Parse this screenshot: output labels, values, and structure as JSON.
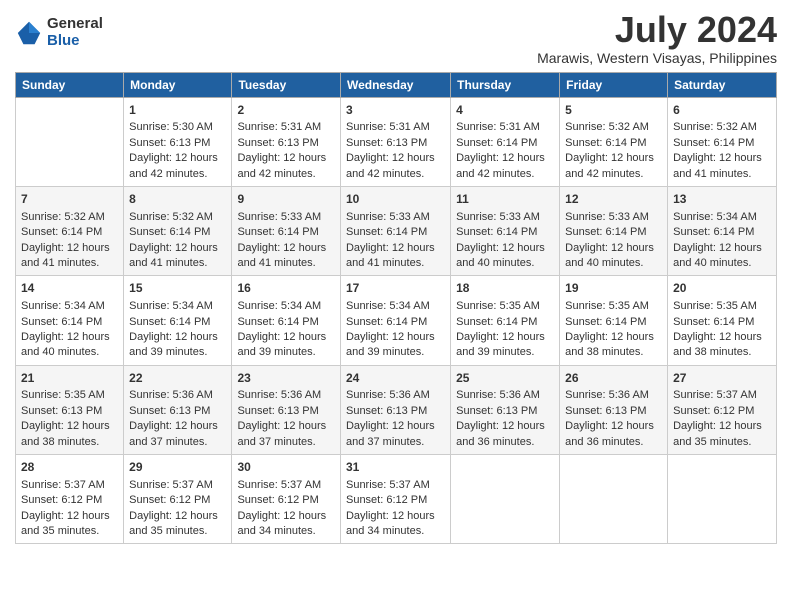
{
  "logo": {
    "general": "General",
    "blue": "Blue"
  },
  "title": {
    "month_year": "July 2024",
    "location": "Marawis, Western Visayas, Philippines"
  },
  "days_of_week": [
    "Sunday",
    "Monday",
    "Tuesday",
    "Wednesday",
    "Thursday",
    "Friday",
    "Saturday"
  ],
  "weeks": [
    [
      {
        "day": "",
        "sunrise": "",
        "sunset": "",
        "daylight": ""
      },
      {
        "day": "1",
        "sunrise": "Sunrise: 5:30 AM",
        "sunset": "Sunset: 6:13 PM",
        "daylight": "Daylight: 12 hours and 42 minutes."
      },
      {
        "day": "2",
        "sunrise": "Sunrise: 5:31 AM",
        "sunset": "Sunset: 6:13 PM",
        "daylight": "Daylight: 12 hours and 42 minutes."
      },
      {
        "day": "3",
        "sunrise": "Sunrise: 5:31 AM",
        "sunset": "Sunset: 6:13 PM",
        "daylight": "Daylight: 12 hours and 42 minutes."
      },
      {
        "day": "4",
        "sunrise": "Sunrise: 5:31 AM",
        "sunset": "Sunset: 6:14 PM",
        "daylight": "Daylight: 12 hours and 42 minutes."
      },
      {
        "day": "5",
        "sunrise": "Sunrise: 5:32 AM",
        "sunset": "Sunset: 6:14 PM",
        "daylight": "Daylight: 12 hours and 42 minutes."
      },
      {
        "day": "6",
        "sunrise": "Sunrise: 5:32 AM",
        "sunset": "Sunset: 6:14 PM",
        "daylight": "Daylight: 12 hours and 41 minutes."
      }
    ],
    [
      {
        "day": "7",
        "sunrise": "Sunrise: 5:32 AM",
        "sunset": "Sunset: 6:14 PM",
        "daylight": "Daylight: 12 hours and 41 minutes."
      },
      {
        "day": "8",
        "sunrise": "Sunrise: 5:32 AM",
        "sunset": "Sunset: 6:14 PM",
        "daylight": "Daylight: 12 hours and 41 minutes."
      },
      {
        "day": "9",
        "sunrise": "Sunrise: 5:33 AM",
        "sunset": "Sunset: 6:14 PM",
        "daylight": "Daylight: 12 hours and 41 minutes."
      },
      {
        "day": "10",
        "sunrise": "Sunrise: 5:33 AM",
        "sunset": "Sunset: 6:14 PM",
        "daylight": "Daylight: 12 hours and 41 minutes."
      },
      {
        "day": "11",
        "sunrise": "Sunrise: 5:33 AM",
        "sunset": "Sunset: 6:14 PM",
        "daylight": "Daylight: 12 hours and 40 minutes."
      },
      {
        "day": "12",
        "sunrise": "Sunrise: 5:33 AM",
        "sunset": "Sunset: 6:14 PM",
        "daylight": "Daylight: 12 hours and 40 minutes."
      },
      {
        "day": "13",
        "sunrise": "Sunrise: 5:34 AM",
        "sunset": "Sunset: 6:14 PM",
        "daylight": "Daylight: 12 hours and 40 minutes."
      }
    ],
    [
      {
        "day": "14",
        "sunrise": "Sunrise: 5:34 AM",
        "sunset": "Sunset: 6:14 PM",
        "daylight": "Daylight: 12 hours and 40 minutes."
      },
      {
        "day": "15",
        "sunrise": "Sunrise: 5:34 AM",
        "sunset": "Sunset: 6:14 PM",
        "daylight": "Daylight: 12 hours and 39 minutes."
      },
      {
        "day": "16",
        "sunrise": "Sunrise: 5:34 AM",
        "sunset": "Sunset: 6:14 PM",
        "daylight": "Daylight: 12 hours and 39 minutes."
      },
      {
        "day": "17",
        "sunrise": "Sunrise: 5:34 AM",
        "sunset": "Sunset: 6:14 PM",
        "daylight": "Daylight: 12 hours and 39 minutes."
      },
      {
        "day": "18",
        "sunrise": "Sunrise: 5:35 AM",
        "sunset": "Sunset: 6:14 PM",
        "daylight": "Daylight: 12 hours and 39 minutes."
      },
      {
        "day": "19",
        "sunrise": "Sunrise: 5:35 AM",
        "sunset": "Sunset: 6:14 PM",
        "daylight": "Daylight: 12 hours and 38 minutes."
      },
      {
        "day": "20",
        "sunrise": "Sunrise: 5:35 AM",
        "sunset": "Sunset: 6:14 PM",
        "daylight": "Daylight: 12 hours and 38 minutes."
      }
    ],
    [
      {
        "day": "21",
        "sunrise": "Sunrise: 5:35 AM",
        "sunset": "Sunset: 6:13 PM",
        "daylight": "Daylight: 12 hours and 38 minutes."
      },
      {
        "day": "22",
        "sunrise": "Sunrise: 5:36 AM",
        "sunset": "Sunset: 6:13 PM",
        "daylight": "Daylight: 12 hours and 37 minutes."
      },
      {
        "day": "23",
        "sunrise": "Sunrise: 5:36 AM",
        "sunset": "Sunset: 6:13 PM",
        "daylight": "Daylight: 12 hours and 37 minutes."
      },
      {
        "day": "24",
        "sunrise": "Sunrise: 5:36 AM",
        "sunset": "Sunset: 6:13 PM",
        "daylight": "Daylight: 12 hours and 37 minutes."
      },
      {
        "day": "25",
        "sunrise": "Sunrise: 5:36 AM",
        "sunset": "Sunset: 6:13 PM",
        "daylight": "Daylight: 12 hours and 36 minutes."
      },
      {
        "day": "26",
        "sunrise": "Sunrise: 5:36 AM",
        "sunset": "Sunset: 6:13 PM",
        "daylight": "Daylight: 12 hours and 36 minutes."
      },
      {
        "day": "27",
        "sunrise": "Sunrise: 5:37 AM",
        "sunset": "Sunset: 6:12 PM",
        "daylight": "Daylight: 12 hours and 35 minutes."
      }
    ],
    [
      {
        "day": "28",
        "sunrise": "Sunrise: 5:37 AM",
        "sunset": "Sunset: 6:12 PM",
        "daylight": "Daylight: 12 hours and 35 minutes."
      },
      {
        "day": "29",
        "sunrise": "Sunrise: 5:37 AM",
        "sunset": "Sunset: 6:12 PM",
        "daylight": "Daylight: 12 hours and 35 minutes."
      },
      {
        "day": "30",
        "sunrise": "Sunrise: 5:37 AM",
        "sunset": "Sunset: 6:12 PM",
        "daylight": "Daylight: 12 hours and 34 minutes."
      },
      {
        "day": "31",
        "sunrise": "Sunrise: 5:37 AM",
        "sunset": "Sunset: 6:12 PM",
        "daylight": "Daylight: 12 hours and 34 minutes."
      },
      {
        "day": "",
        "sunrise": "",
        "sunset": "",
        "daylight": ""
      },
      {
        "day": "",
        "sunrise": "",
        "sunset": "",
        "daylight": ""
      },
      {
        "day": "",
        "sunrise": "",
        "sunset": "",
        "daylight": ""
      }
    ]
  ]
}
